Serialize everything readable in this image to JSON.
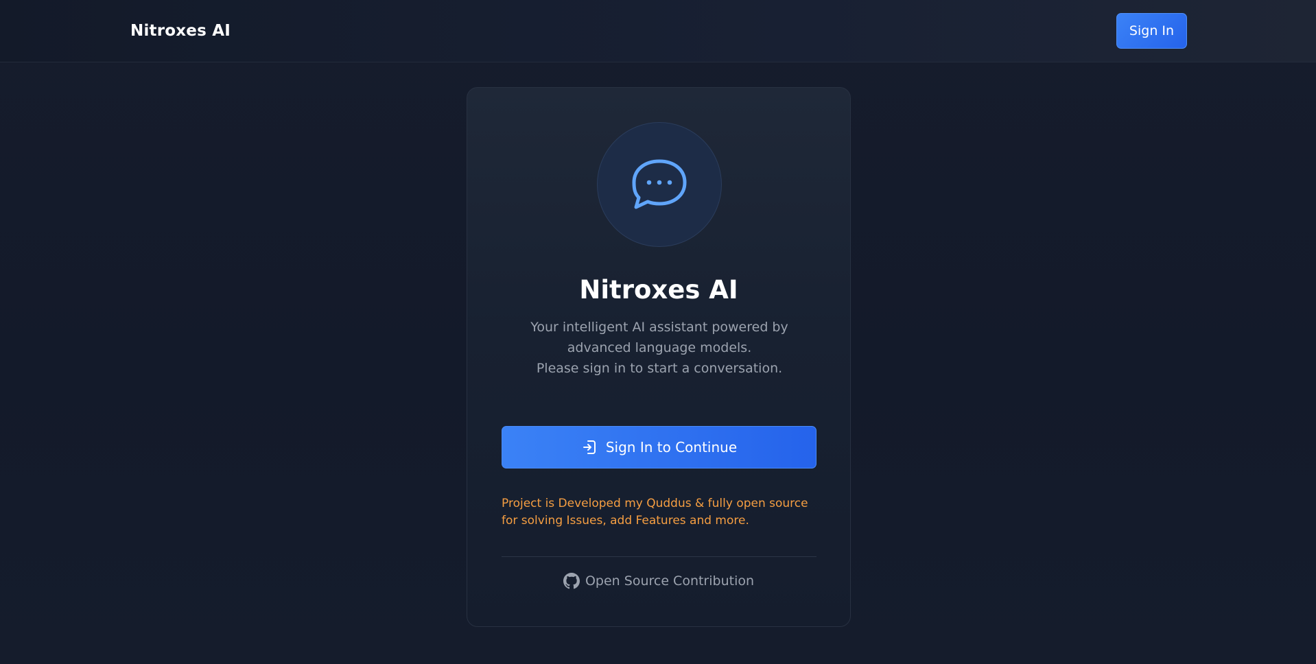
{
  "header": {
    "brand": "Nitroxes AI",
    "signin_label": "Sign In"
  },
  "card": {
    "logo_icon": "chat-bubble-icon",
    "title": "Nitroxes AI",
    "description_line1": "Your intelligent AI assistant powered by advanced language models.",
    "description_line2": "Please sign in to start a conversation.",
    "continue_label": "Sign In to Continue",
    "continue_icon": "login-icon",
    "notice": "Project is Developed my Quddus & fully open source for solving Issues, add Features and more.",
    "oss_icon": "github-icon",
    "oss_label": "Open Source Contribution"
  },
  "colors": {
    "accent": "#3b82f6",
    "notice": "#f59e42",
    "muted_text": "#9ca3af",
    "background": "#151c2c"
  }
}
